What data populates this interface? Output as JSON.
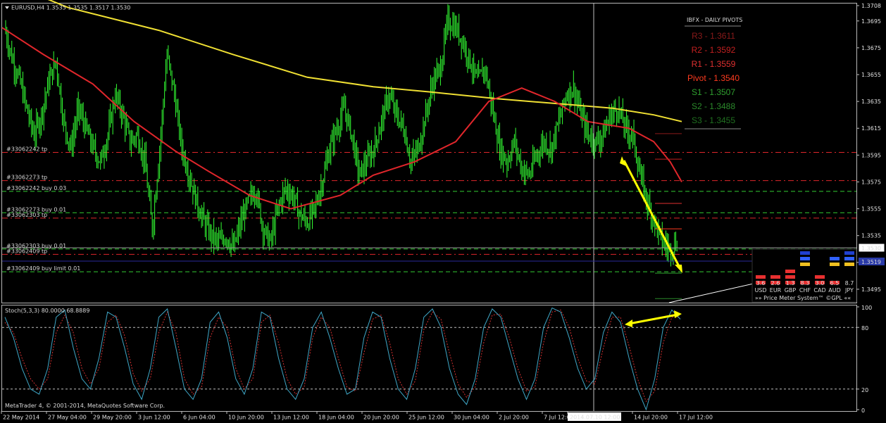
{
  "chart_data": [
    {
      "type": "candlestick",
      "title": "EURUSD,H4  1.3535 1.3535 1.3517 1.3530",
      "symbol": "EURUSD",
      "timeframe": "H4",
      "ohlc": {
        "open": 1.3535,
        "high": 1.3535,
        "low": 1.3517,
        "close": 1.353
      },
      "ylim": [
        1.3485,
        1.3708
      ],
      "y_ticks": [
        "1.3708",
        "1.3695",
        "1.3675",
        "1.3655",
        "1.3635",
        "1.3615",
        "1.3595",
        "1.3575",
        "1.3555",
        "1.3535",
        "1.3515",
        "1.3495"
      ],
      "current_price": "1.3530",
      "bid_price": "1.3519",
      "x_ticks": [
        "22 May 2014",
        "27 May 04:00",
        "29 May 20:00",
        "3 Jun 12:00",
        "6 Jun 04:00",
        "10 Jun 20:00",
        "13 Jun 12:00",
        "18 Jun 04:00",
        "20 Jun 20:00",
        "25 Jun 12:00",
        "30 Jun 04:00",
        "2 Jul 20:00",
        "7 Jul 12:00",
        "2014.07.10 12:00",
        "14 Jul 20:00",
        "17 Jul 12:00"
      ],
      "price_path": [
        1.369,
        1.3668,
        1.3652,
        1.363,
        1.361,
        1.3625,
        1.365,
        1.3665,
        1.362,
        1.36,
        1.363,
        1.3615,
        1.36,
        1.359,
        1.361,
        1.364,
        1.3625,
        1.3605,
        1.361,
        1.359,
        1.354,
        1.36,
        1.367,
        1.364,
        1.36,
        1.358,
        1.356,
        1.3545,
        1.3535,
        1.353,
        1.3535,
        1.3525,
        1.3545,
        1.356,
        1.357,
        1.354,
        1.353,
        1.3555,
        1.357,
        1.3565,
        1.355,
        1.3545,
        1.3555,
        1.3575,
        1.36,
        1.3615,
        1.363,
        1.361,
        1.358,
        1.359,
        1.36,
        1.362,
        1.364,
        1.3625,
        1.3615,
        1.359,
        1.36,
        1.3625,
        1.365,
        1.366,
        1.3695,
        1.369,
        1.368,
        1.3665,
        1.365,
        1.366,
        1.363,
        1.36,
        1.359,
        1.3605,
        1.3585,
        1.358,
        1.3595,
        1.3605,
        1.36,
        1.362,
        1.364,
        1.3645,
        1.3625,
        1.361,
        1.3605,
        1.361,
        1.3625,
        1.363,
        1.3615,
        1.361,
        1.358,
        1.356,
        1.3545,
        1.353,
        1.3525,
        1.353
      ],
      "ma_slow_color": "#f0e033",
      "ma_fast_color": "#e0262b",
      "candle_color": "#33ff33",
      "ma_slow": [
        [
          0,
          1.3725
        ],
        [
          40,
          1.3705
        ],
        [
          95,
          1.3688
        ],
        [
          140,
          1.367
        ],
        [
          185,
          1.3653
        ],
        [
          225,
          1.3646
        ],
        [
          260,
          1.3642
        ],
        [
          300,
          1.3637
        ],
        [
          340,
          1.3633
        ],
        [
          370,
          1.363
        ],
        [
          395,
          1.3625
        ],
        [
          412,
          1.362
        ]
      ],
      "ma_fast": [
        [
          0,
          1.369
        ],
        [
          25,
          1.367
        ],
        [
          55,
          1.3648
        ],
        [
          80,
          1.362
        ],
        [
          105,
          1.3598
        ],
        [
          125,
          1.3583
        ],
        [
          150,
          1.3565
        ],
        [
          175,
          1.3555
        ],
        [
          205,
          1.3565
        ],
        [
          225,
          1.358
        ],
        [
          250,
          1.359
        ],
        [
          275,
          1.3605
        ],
        [
          295,
          1.3635
        ],
        [
          315,
          1.3645
        ],
        [
          335,
          1.3635
        ],
        [
          355,
          1.362
        ],
        [
          380,
          1.3615
        ],
        [
          395,
          1.3605
        ],
        [
          405,
          1.359
        ],
        [
          412,
          1.3575
        ]
      ],
      "orders": [
        {
          "label": "#33062242 tp",
          "price": 1.3597,
          "color": "#e0262b",
          "dash": "8,4,2,4"
        },
        {
          "label": "#33062273 tp",
          "price": 1.3576,
          "color": "#e0262b",
          "dash": "8,4,2,4"
        },
        {
          "label": "#33062242 buy 0.03",
          "price": 1.3568,
          "color": "#33cc33",
          "dash": "6,4"
        },
        {
          "label": "#33062273 buy 0.01",
          "price": 1.3552,
          "color": "#33cc33",
          "dash": "6,4"
        },
        {
          "label": "#33062303 tp",
          "price": 1.3548,
          "color": "#e0262b",
          "dash": "8,4,2,4"
        },
        {
          "label": "#33062303 buy 0.01",
          "price": 1.3525,
          "color": "#33cc33",
          "dash": "6,4"
        },
        {
          "label": "#33062409 tp",
          "price": 1.3521,
          "color": "#e0262b",
          "dash": "8,4,2,4"
        },
        {
          "label": "#33062409 buy limit 0.01",
          "price": 1.3508,
          "color": "#33cc33",
          "dash": "6,4"
        }
      ],
      "pivots": {
        "header": "IBFX - DAILY PIVOTS",
        "levels": [
          {
            "label": "R3 - 1.3611",
            "value": 1.3611,
            "color": "#8b1a1a"
          },
          {
            "label": "R2 - 1.3592",
            "value": 1.3592,
            "color": "#c42020"
          },
          {
            "label": "R1 - 1.3559",
            "value": 1.3559,
            "color": "#e03030"
          },
          {
            "label": "Pivot - 1.3540",
            "value": 1.354,
            "color": "#ff3b1f"
          },
          {
            "label": "S1 - 1.3507",
            "value": 1.3507,
            "color": "#2fa02f"
          },
          {
            "label": "S2 - 1.3488",
            "value": 1.3488,
            "color": "#2b8a2b"
          },
          {
            "label": "S3 - 1.3455",
            "value": 1.3455,
            "color": "#207020"
          }
        ]
      },
      "price_meter": {
        "title": "»» Price Meter System™ ©GPL ««",
        "currencies": [
          "USD",
          "EUR",
          "GBP",
          "CHF",
          "CAD",
          "AUD",
          "JPY"
        ],
        "values": [
          "3.6",
          "2.6",
          "1.3",
          "8.3",
          "3.0",
          "6.5",
          "8.7"
        ]
      },
      "annotations": [
        "yellow arrow from 2014.07.11 high to 2014.07.17 low"
      ]
    },
    {
      "type": "line",
      "title": "Stoch(5,3,3) 80.0000 68.8889",
      "ylim": [
        0,
        100
      ],
      "y_ticks": [
        "100",
        "80",
        "20",
        "0"
      ],
      "levels": [
        80,
        20
      ],
      "series": [
        {
          "name": "main",
          "color": "#3fa7c7",
          "values": [
            90,
            70,
            40,
            20,
            15,
            40,
            90,
            97,
            60,
            30,
            20,
            50,
            95,
            90,
            60,
            25,
            10,
            40,
            90,
            98,
            60,
            20,
            10,
            30,
            85,
            95,
            70,
            30,
            15,
            40,
            95,
            90,
            50,
            20,
            10,
            30,
            80,
            95,
            70,
            40,
            15,
            20,
            70,
            95,
            90,
            50,
            20,
            10,
            40,
            90,
            98,
            80,
            40,
            15,
            5,
            30,
            80,
            98,
            90,
            60,
            30,
            10,
            30,
            80,
            99,
            95,
            70,
            40,
            20,
            30,
            75,
            95,
            85,
            50,
            20,
            0,
            30,
            80,
            97,
            88
          ]
        },
        {
          "name": "signal",
          "color": "#d03030",
          "values": [
            85,
            75,
            50,
            30,
            20,
            30,
            75,
            92,
            75,
            40,
            25,
            40,
            85,
            92,
            72,
            35,
            18,
            30,
            75,
            95,
            75,
            30,
            15,
            22,
            70,
            90,
            80,
            40,
            20,
            30,
            85,
            92,
            65,
            30,
            15,
            22,
            70,
            90,
            80,
            50,
            22,
            18,
            55,
            88,
            92,
            65,
            30,
            15,
            28,
            78,
            95,
            88,
            55,
            25,
            12,
            22,
            65,
            92,
            93,
            70,
            40,
            18,
            22,
            65,
            95,
            97,
            80,
            50,
            28,
            25,
            60,
            90,
            90,
            62,
            30,
            8,
            18,
            65,
            90,
            90
          ]
        }
      ],
      "annotations": [
        "yellow double-headed arrow across two stochastic peaks"
      ]
    }
  ],
  "footer": {
    "copyright": "MetaTrader 4, © 2001-2014, MetaQuotes Software Corp."
  },
  "colors": {
    "background": "#000000",
    "axis": "#c0c0c0",
    "crosshair": "#d0d0d0",
    "arrow": "#ffff00"
  }
}
